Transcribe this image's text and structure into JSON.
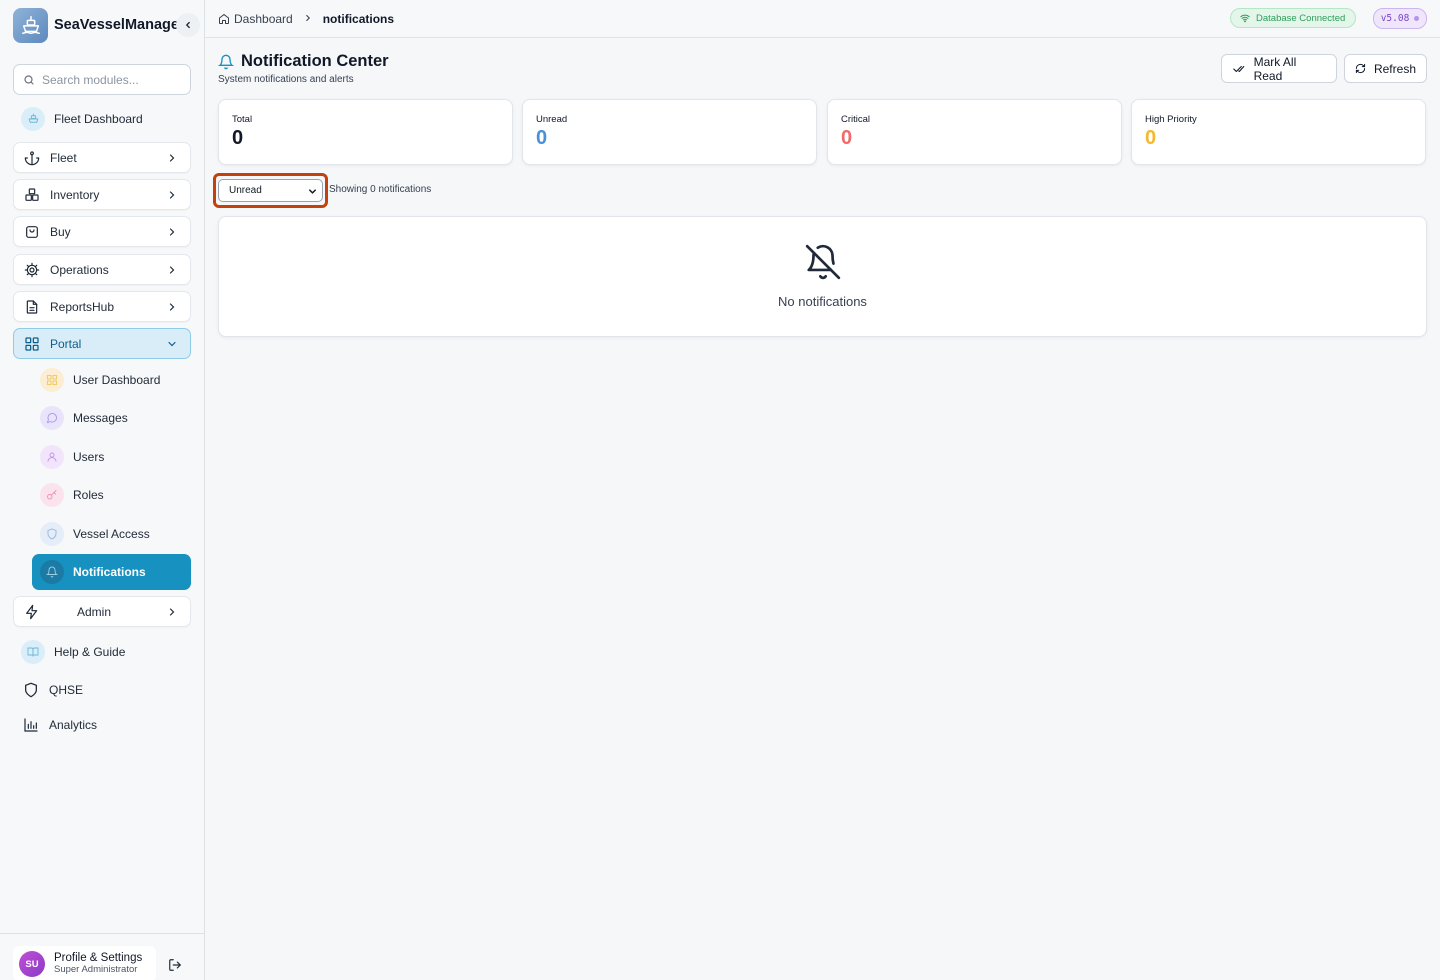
{
  "app": {
    "name": "SeaVesselManager"
  },
  "search": {
    "placeholder": "Search modules..."
  },
  "sidebar": {
    "items": [
      {
        "label": "Fleet Dashboard"
      },
      {
        "label": "Fleet"
      },
      {
        "label": "Inventory"
      },
      {
        "label": "Buy"
      },
      {
        "label": "Operations"
      },
      {
        "label": "ReportsHub"
      },
      {
        "label": "Portal"
      }
    ],
    "portal_sub": [
      {
        "label": "User Dashboard"
      },
      {
        "label": "Messages"
      },
      {
        "label": "Users"
      },
      {
        "label": "Roles"
      },
      {
        "label": "Vessel Access"
      },
      {
        "label": "Notifications"
      }
    ],
    "admin": {
      "label": "Admin"
    },
    "extras": [
      {
        "label": "Help & Guide"
      },
      {
        "label": "QHSE"
      },
      {
        "label": "Analytics"
      }
    ]
  },
  "profile": {
    "initials": "SU",
    "name": "Profile & Settings",
    "role": "Super Administrator"
  },
  "breadcrumb": {
    "home": "Dashboard",
    "current": "notifications"
  },
  "status": {
    "db": "Database Connected",
    "version": "v5.08"
  },
  "page": {
    "title": "Notification Center",
    "subtitle": "System notifications and alerts"
  },
  "actions": {
    "mark_all_read": "Mark All Read",
    "refresh": "Refresh"
  },
  "stats": [
    {
      "label": "Total",
      "value": "0",
      "color": "#111827"
    },
    {
      "label": "Unread",
      "value": "0",
      "color": "#4a90d9"
    },
    {
      "label": "Critical",
      "value": "0",
      "color": "#ef6b6b"
    },
    {
      "label": "High Priority",
      "value": "0",
      "color": "#f5b82e"
    }
  ],
  "filter": {
    "selected": "Unread",
    "summary": "Showing 0 notifications"
  },
  "empty": {
    "message": "No notifications"
  }
}
